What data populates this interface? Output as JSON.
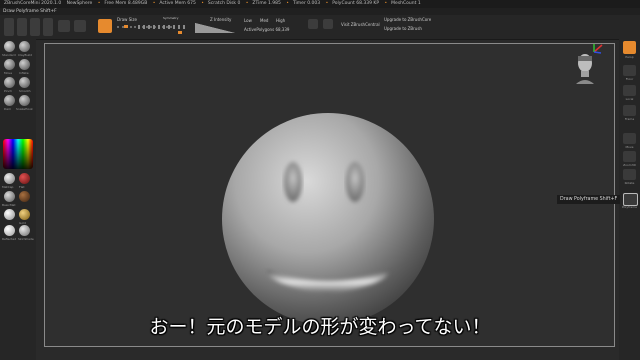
{
  "titlebar": {
    "app": "ZBrushCoreMini 2020.1.0",
    "document": "NewSphere",
    "free_mem": "Free Mem 8.489GB",
    "active_mem": "Active Mem 675",
    "scratch": "Scratch Disk 0",
    "ztime": "ZTime 1.985",
    "timer": "Timer 0.003",
    "polycount": "PolyCount 68.339 KP",
    "meshcount": "MeshCount 1"
  },
  "subbar": {
    "text": "Draw Polyframe Shift+F"
  },
  "toolbar": {
    "draw_size_label": "Draw Size",
    "symmetry_label": "Symmetry",
    "zintensity_label": "Z Intensity",
    "low": "Low",
    "med": "Med",
    "high": "High",
    "active_polygons": "ActivePolygons 68,339",
    "visit": "Visit ZBrushCentral",
    "upgrade1": "Upgrade to ZBrushCore",
    "upgrade2": "Upgrade to ZBrush"
  },
  "left_panel": {
    "items": [
      "Standard",
      "ClayBuild",
      "Move",
      "Inflate",
      "Pinch",
      "Smooth",
      "Dam",
      "SnakeHook",
      "MatCap",
      "Flat",
      "BasicMat",
      "Gold",
      "Reflected",
      "SkinShade"
    ]
  },
  "right_panel": {
    "items": [
      "Persp",
      "Floor",
      "Local",
      "Frame",
      "Move",
      "Zoom3D",
      "Rotate",
      "Polyframe"
    ]
  },
  "tooltip": {
    "text": "Draw Polyframe  Shift+F"
  },
  "subtitle": {
    "text": "おー！元のモデルの形が変わってない！"
  },
  "colors": {
    "accent": "#e68a2e",
    "canvas_bg": "#2f2f2f",
    "panel_bg": "#262626"
  }
}
